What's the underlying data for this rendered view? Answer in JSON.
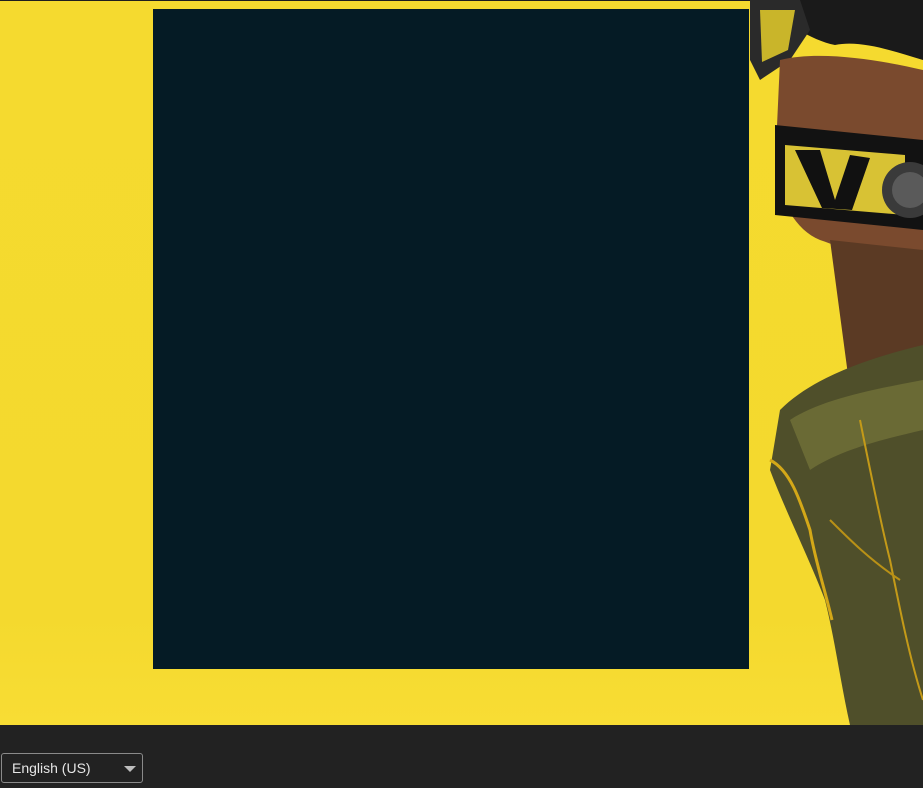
{
  "footer": {
    "language_selected": "English (US)"
  },
  "colors": {
    "hero_yellow": "#f5da2f",
    "panel_dark": "#051b25",
    "footer_bg": "#222222"
  },
  "icons": {
    "language_caret": "caret-down-icon"
  }
}
